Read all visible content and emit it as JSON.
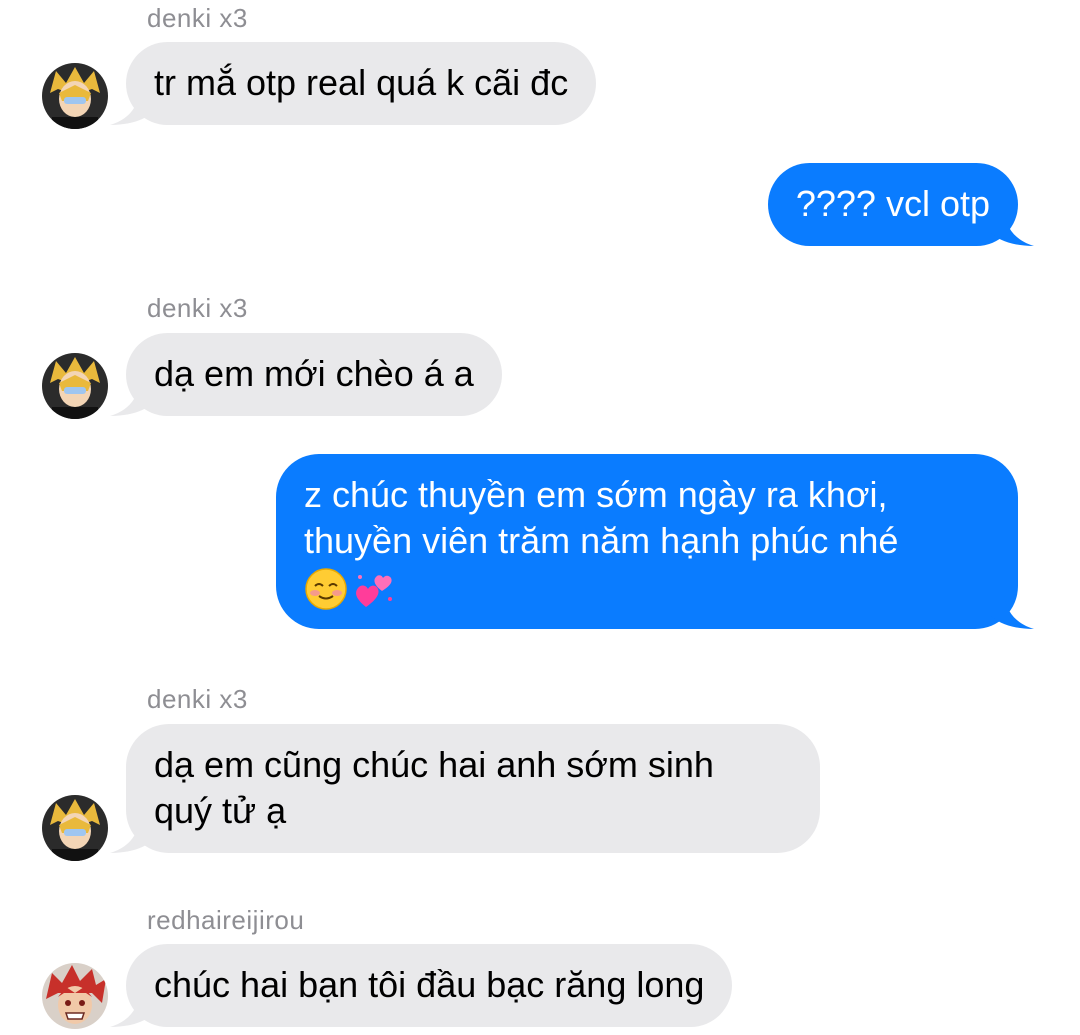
{
  "messages": [
    {
      "sender": "denki x3",
      "text": "tr mắ otp real quá k cãi đc",
      "avatar": "denki-avatar"
    },
    {
      "text": "???? vcl otp"
    },
    {
      "sender": "denki x3",
      "text": "dạ em mới chèo á a",
      "avatar": "denki-avatar"
    },
    {
      "text": "z chúc thuyền em sớm ngày ra khơi,\nthuyền viên trăm năm hạnh phúc nhé",
      "emojis": [
        "smiling-face-emoji",
        "two-hearts-emoji"
      ]
    },
    {
      "sender": "denki x3",
      "text": "dạ em cũng chúc hai anh sớm sinh\nquý tử ạ",
      "avatar": "denki-avatar"
    },
    {
      "sender": "redhaireijirou",
      "text": "chúc hai bạn tôi đầu bạc răng long",
      "avatar": "kirishima-avatar"
    }
  ],
  "colors": {
    "incoming_bubble": "#e9e9eb",
    "outgoing_bubble": "#0a7cff",
    "sender_name": "#8e8e93"
  }
}
